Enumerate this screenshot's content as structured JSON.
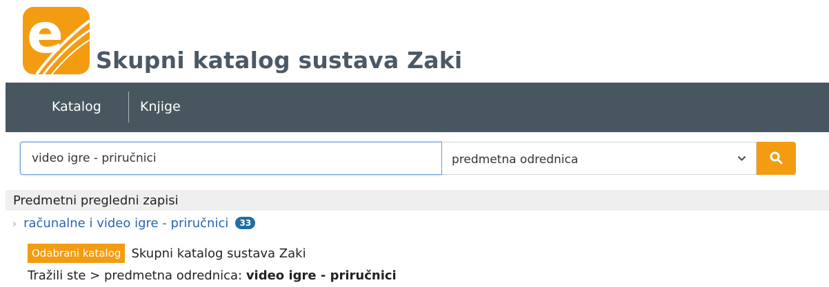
{
  "brand": {
    "logo_letter": "e",
    "title": "Skupni katalog sustava Zaki",
    "accent_color": "#f39c12"
  },
  "nav": {
    "items": [
      {
        "label": "Katalog"
      },
      {
        "label": "Knjige"
      }
    ],
    "bg_color": "#48575f"
  },
  "search": {
    "query": "video igre - priručnici",
    "field_type": "predmetna odrednica",
    "button_icon": "search-icon"
  },
  "results": {
    "section_title": "Predmetni pregledni zapisi",
    "items": [
      {
        "label": "računalne i video igre - priručnici",
        "count": "33"
      }
    ]
  },
  "catalog": {
    "tag_label": "Odabrani katalog",
    "name": "Skupni katalog sustava Zaki"
  },
  "query_summary": {
    "prefix": "Tražili ste > predmetna odrednica: ",
    "term": "video igre - priručnici"
  }
}
